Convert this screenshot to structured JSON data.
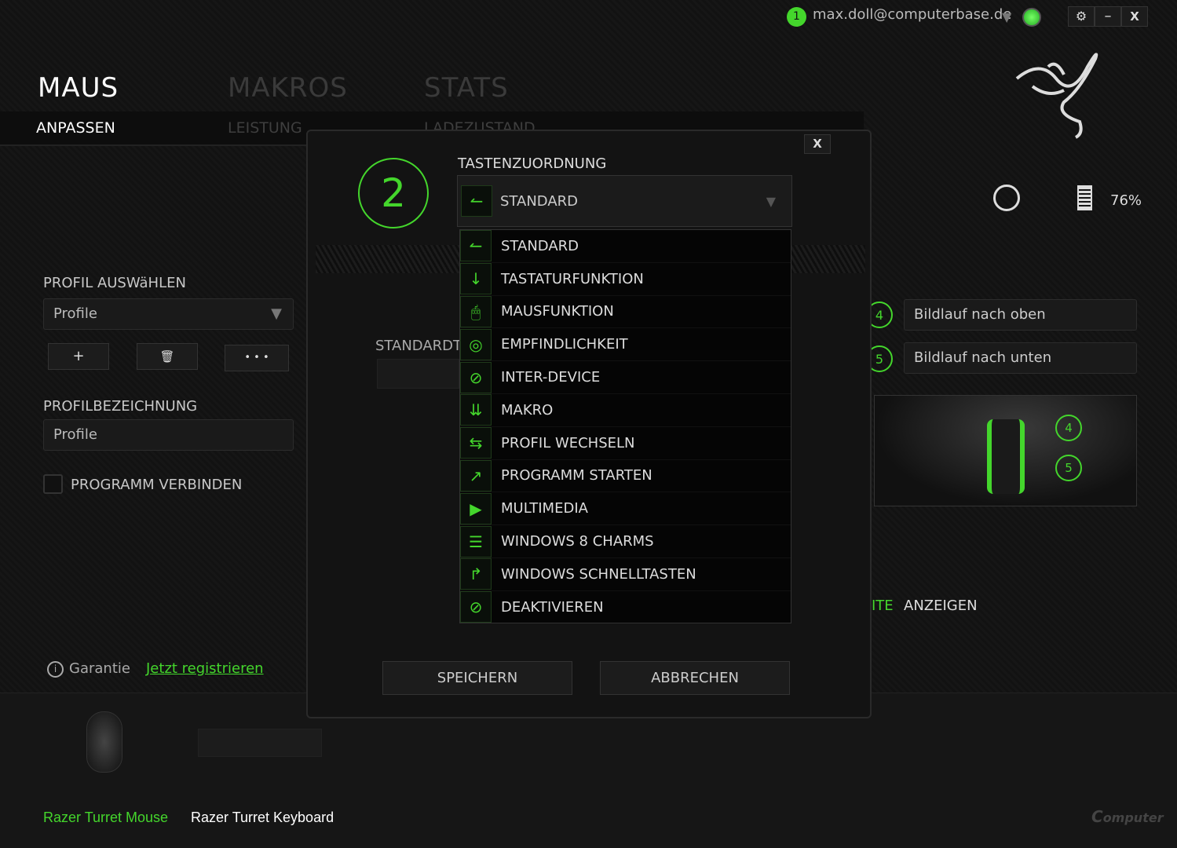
{
  "topbar": {
    "notification_count": "1",
    "account": "max.doll@computerbase.de",
    "settings": "⚙",
    "minimize": "–",
    "close": "X"
  },
  "tabs": [
    {
      "label": "MAUS"
    },
    {
      "label": "MAKROS"
    },
    {
      "label": "STATS"
    }
  ],
  "subtabs": [
    {
      "label": "ANPASSEN"
    },
    {
      "label": "LEISTUNG"
    },
    {
      "label": "LADEZUSTAND"
    }
  ],
  "left": {
    "profile_select_label": "PROFIL AUSWäHLEN",
    "profile_select_value": "Profile",
    "add": "+",
    "delete": "🗑",
    "more": "• • •",
    "profile_name_label": "PROFILBEZEICHNUNG",
    "profile_name_value": "Profile",
    "link_program": "PROGRAMM VERBINDEN",
    "warranty": "Garantie",
    "register": "Jetzt registrieren"
  },
  "status": {
    "battery": "76%",
    "battery_level": 76
  },
  "right": {
    "keys": [
      {
        "num": "4",
        "label": "Bildlauf nach oben"
      },
      {
        "num": "5",
        "label": "Bildlauf nach unten"
      }
    ],
    "show_partial": "ITE",
    "show": "ANZEIGEN"
  },
  "devices": [
    {
      "name": "Razer Turret Mouse",
      "active": true
    },
    {
      "name": "Razer Turret Keyboard",
      "active": false
    }
  ],
  "modal": {
    "button_number": "2",
    "title": "TASTENZUORDNUNG",
    "selected": "STANDARD",
    "behind_label": "STANDARDT",
    "close": "X",
    "save": "SPEICHERN",
    "cancel": "ABBRECHEN",
    "options": [
      {
        "label": "STANDARD",
        "icon": "standard-icon",
        "glyph": "↼"
      },
      {
        "label": "TASTATURFUNKTION",
        "icon": "keyboard-icon",
        "glyph": "↓"
      },
      {
        "label": "MAUSFUNKTION",
        "icon": "mouse-icon",
        "glyph": "🖱"
      },
      {
        "label": "EMPFINDLICHKEIT",
        "icon": "sensitivity-icon",
        "glyph": "◎"
      },
      {
        "label": "INTER-DEVICE",
        "icon": "inter-device-icon",
        "glyph": "⊘"
      },
      {
        "label": "MAKRO",
        "icon": "macro-icon",
        "glyph": "⇊"
      },
      {
        "label": "PROFIL WECHSELN",
        "icon": "switch-profile-icon",
        "glyph": "⇆"
      },
      {
        "label": "PROGRAMM STARTEN",
        "icon": "launch-program-icon",
        "glyph": "↗"
      },
      {
        "label": "MULTIMEDIA",
        "icon": "multimedia-icon",
        "glyph": "▶"
      },
      {
        "label": "WINDOWS 8 CHARMS",
        "icon": "charms-icon",
        "glyph": "☰"
      },
      {
        "label": "WINDOWS SCHNELLTASTEN",
        "icon": "shortcut-icon",
        "glyph": "↱"
      },
      {
        "label": "DEAKTIVIEREN",
        "icon": "disable-icon",
        "glyph": "⊘"
      }
    ]
  },
  "colors": {
    "accent": "#44d62c"
  },
  "watermark": "ComputerBase"
}
